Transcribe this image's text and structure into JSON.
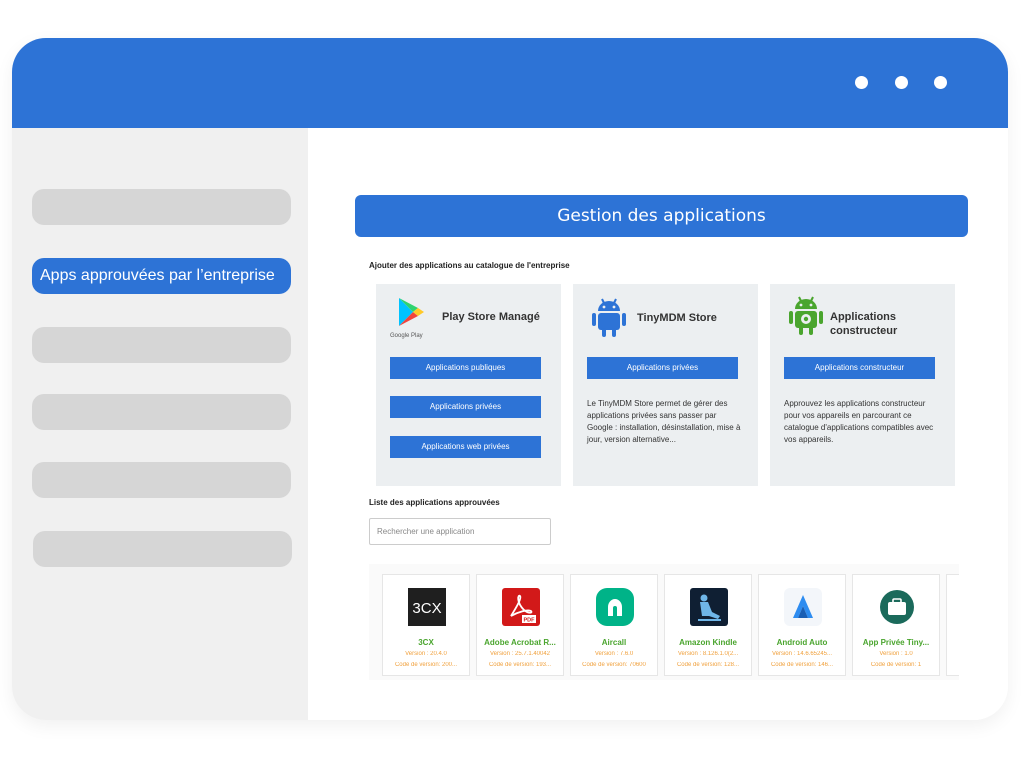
{
  "sidebar": {
    "active_item": "Apps approuvées par l’entreprise"
  },
  "main": {
    "header_title": "Gestion des applications",
    "add_section_label": "Ajouter des applications au catalogue de l'entreprise",
    "cards": [
      {
        "title": "Play Store Managé",
        "logo_caption": "Google Play",
        "icon": "google-play-icon",
        "buttons": [
          "Applications publiques",
          "Applications privées",
          "Applications web privées"
        ]
      },
      {
        "title": "TinyMDM Store",
        "icon": "android-icon",
        "buttons": [
          "Applications privées"
        ],
        "description": "Le TinyMDM Store permet de gérer des applications privées sans passer par Google : installation, désinstallation, mise à jour, version alternative..."
      },
      {
        "title": "Applications constructeur",
        "icon": "android-gear-icon",
        "buttons": [
          "Applications constructeur"
        ],
        "description": "Approuvez les applications constructeur pour vos appareils en parcourant ce catalogue d'applications compatibles avec vos appareils."
      }
    ],
    "list_label": "Liste des applications approuvées",
    "search_placeholder": "Rechercher une application",
    "apps": [
      {
        "name": "3CX",
        "version": "Version : 20.4.0",
        "code": "Code de version: 200...",
        "icon": "3cx-icon"
      },
      {
        "name": "Adobe Acrobat R...",
        "version": "Version : 25.7.1.40042",
        "code": "Code de version: 193...",
        "icon": "adobe-pdf-icon"
      },
      {
        "name": "Aircall",
        "version": "Version : 7.6.0",
        "code": "Code de version: 70600",
        "icon": "aircall-icon"
      },
      {
        "name": "Amazon Kindle",
        "version": "Version : 8.126.1.0(2...",
        "code": "Code de version: 128...",
        "icon": "kindle-icon"
      },
      {
        "name": "Android Auto",
        "version": "Version : 14.6.65245...",
        "code": "Code de version: 146...",
        "icon": "android-auto-icon"
      },
      {
        "name": "App Privée Tiny...",
        "version": "Version : 1.0",
        "code": "Code de version: 1",
        "icon": "briefcase-icon"
      }
    ]
  },
  "colors": {
    "primary": "#2d73d6",
    "app_name": "#4aa52e",
    "app_meta": "#f0a03c"
  }
}
